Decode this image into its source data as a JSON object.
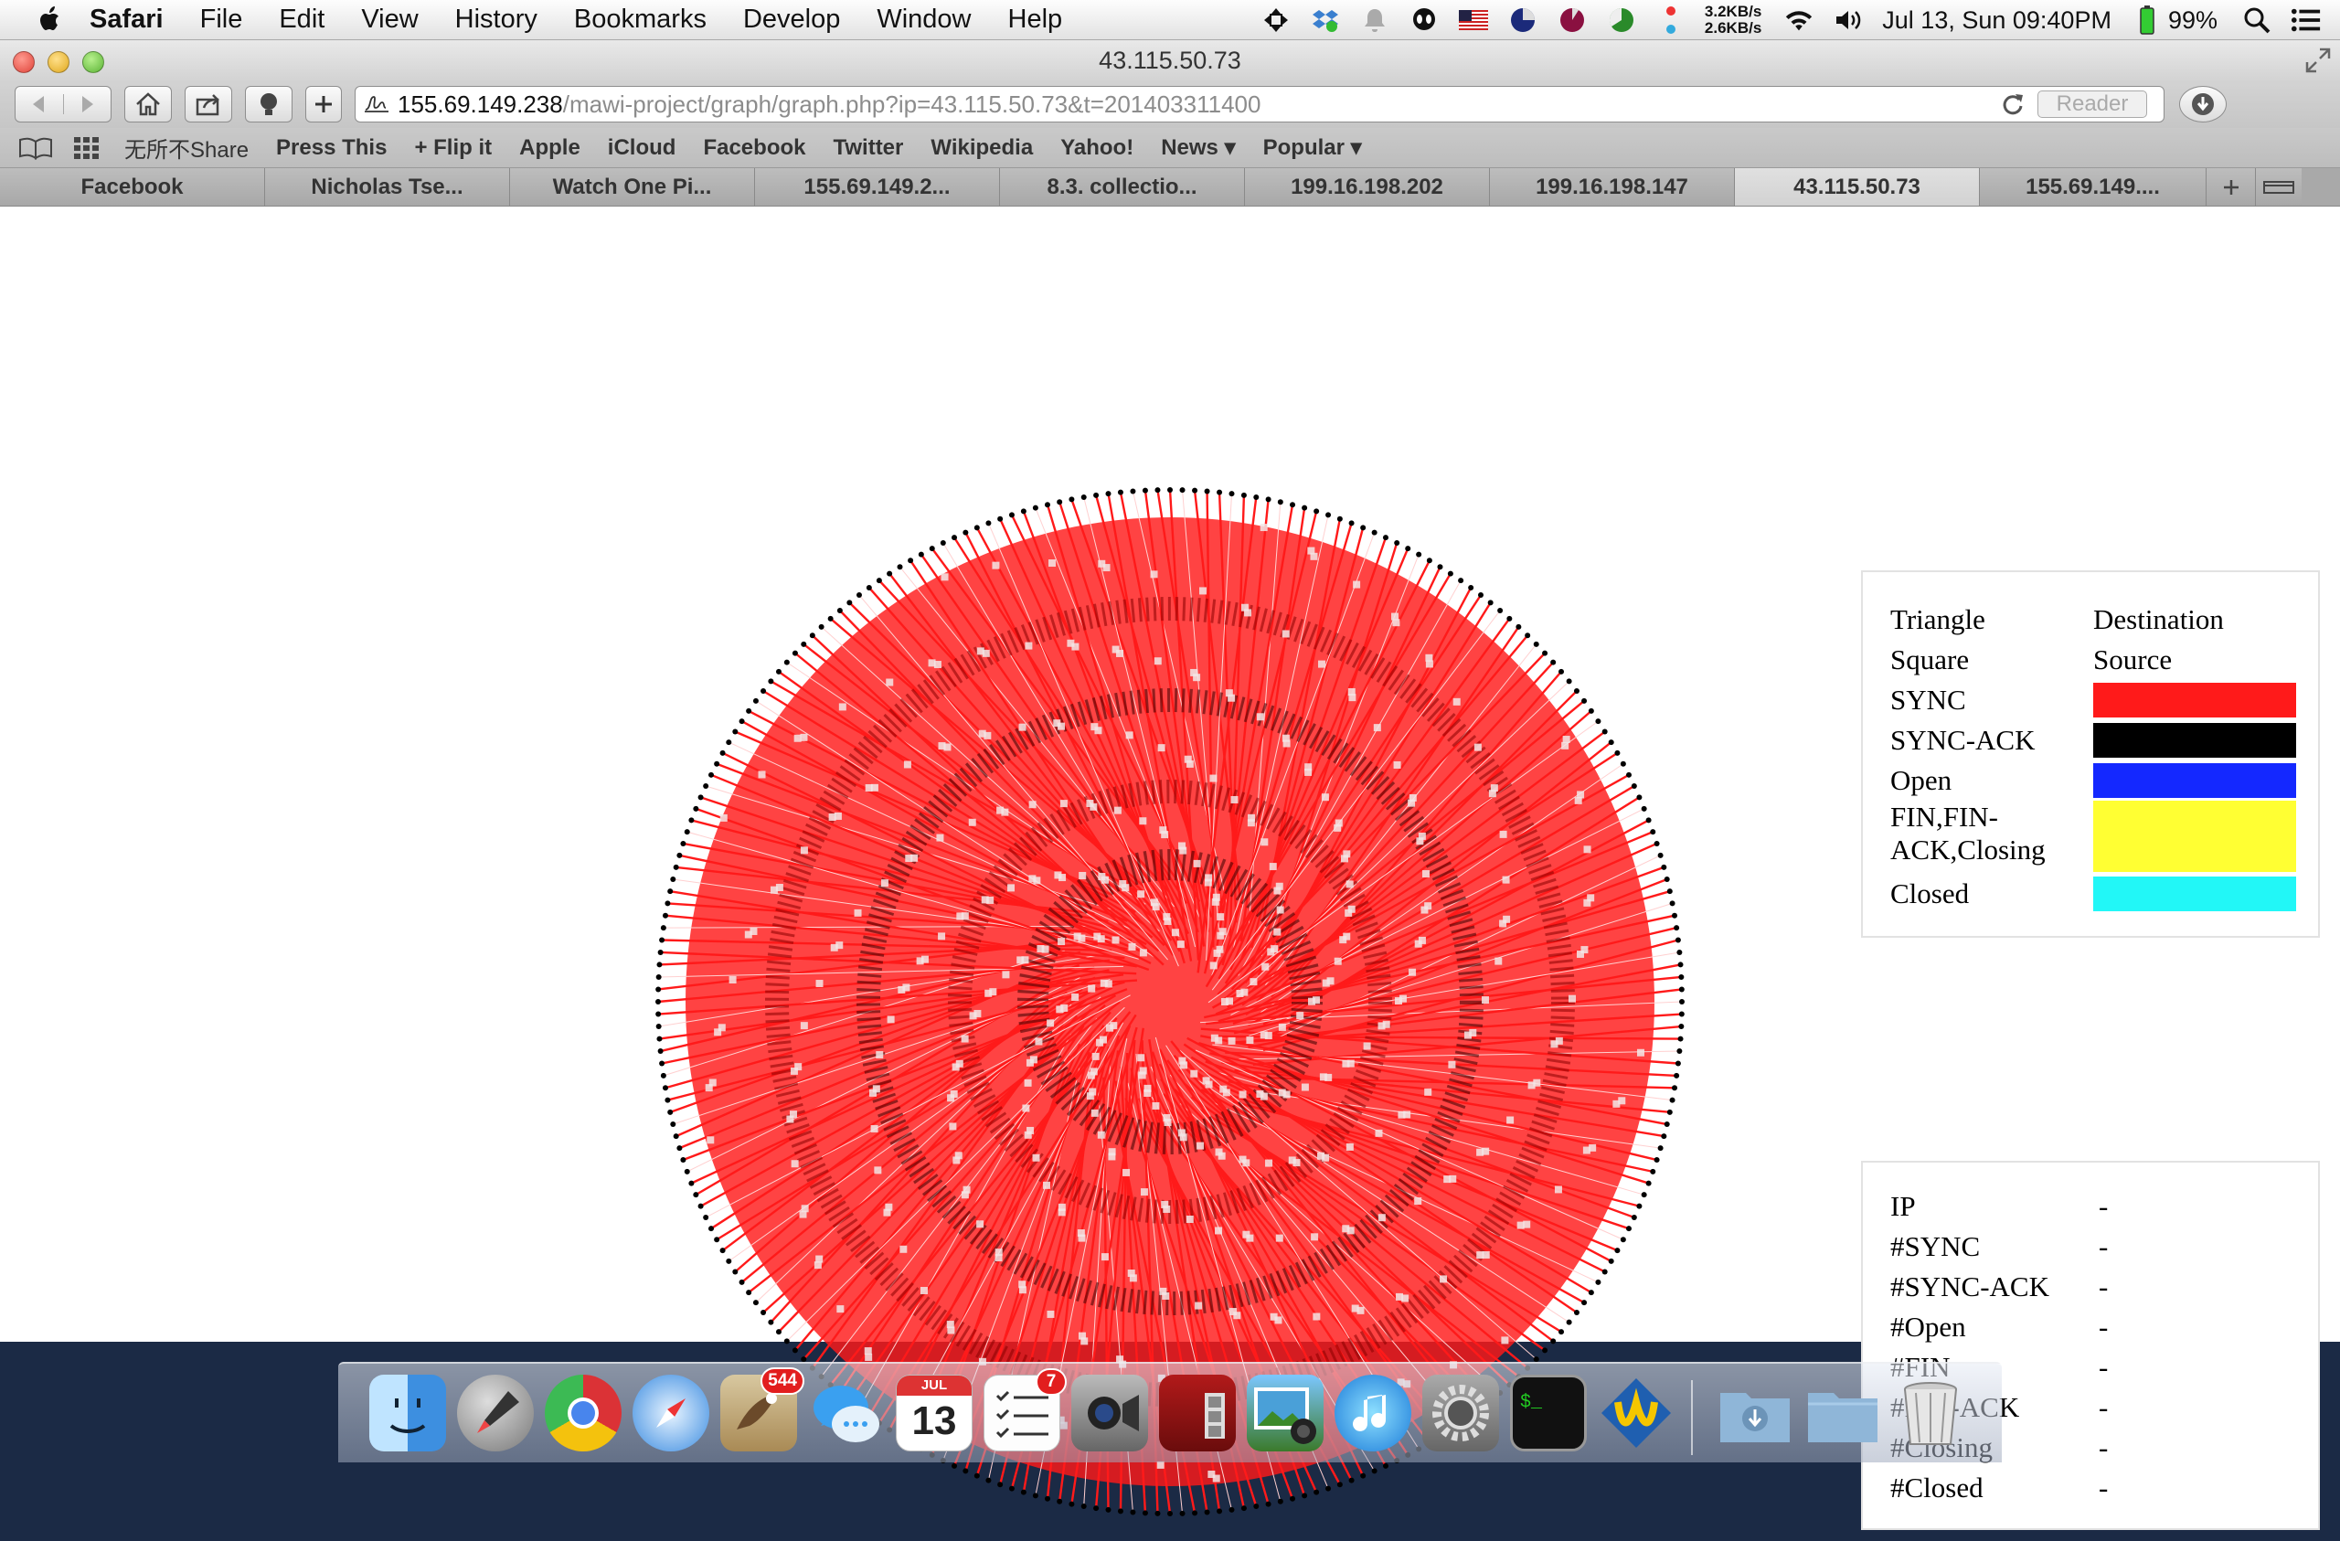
{
  "menubar": {
    "app": "Safari",
    "items": [
      "File",
      "Edit",
      "View",
      "History",
      "Bookmarks",
      "Develop",
      "Window",
      "Help"
    ],
    "net_up": "3.2KB/s",
    "net_down": "2.6KB/s",
    "datetime": "Jul 13, Sun 09:40PM",
    "battery": "99%"
  },
  "window": {
    "title": "43.115.50.73"
  },
  "toolbar": {
    "url_host": "155.69.149.238",
    "url_path": "/mawi-project/graph/graph.php?ip=43.115.50.73&t=201403311400",
    "reader_label": "Reader"
  },
  "bookmarks": [
    "无所不Share",
    "Press This",
    "+ Flip it",
    "Apple",
    "iCloud",
    "Facebook",
    "Twitter",
    "Wikipedia",
    "Yahoo!",
    "News ▾",
    "Popular ▾"
  ],
  "tabs": [
    "Facebook",
    "Nicholas Tse...",
    "Watch One Pi...",
    "155.69.149.2...",
    "8.3. collectio...",
    "199.16.198.202",
    "199.16.198.147",
    "43.115.50.73",
    "155.69.149...."
  ],
  "active_tab": 7,
  "legend": {
    "rows": [
      {
        "key": "Triangle",
        "value": "Destination"
      },
      {
        "key": "Square",
        "value": "Source"
      }
    ],
    "states": [
      {
        "key": "SYNC",
        "color": "#ff1a1a"
      },
      {
        "key": "SYNC-ACK",
        "color": "#000000"
      },
      {
        "key": "Open",
        "color": "#1428ff"
      },
      {
        "key": "FIN,FIN-ACK,Closing",
        "color": "#ffff33"
      },
      {
        "key": "Closed",
        "color": "#22f7f7"
      }
    ]
  },
  "stats": [
    {
      "key": "IP",
      "value": "-"
    },
    {
      "key": "#SYNC",
      "value": "-"
    },
    {
      "key": "#SYNC-ACK",
      "value": "-"
    },
    {
      "key": "#Open",
      "value": "-"
    },
    {
      "key": "#FIN",
      "value": "-"
    },
    {
      "key": "#FIN-ACK",
      "value": "-"
    },
    {
      "key": "#Closing",
      "value": "-"
    },
    {
      "key": "#Closed",
      "value": "-"
    }
  ],
  "graph": {
    "edge_color": "#ff1a1a",
    "node_color": "#000000"
  },
  "dock": {
    "mail_badge": "544",
    "reminders_badge": "7",
    "calendar_month": "JUL",
    "calendar_day": "13"
  }
}
